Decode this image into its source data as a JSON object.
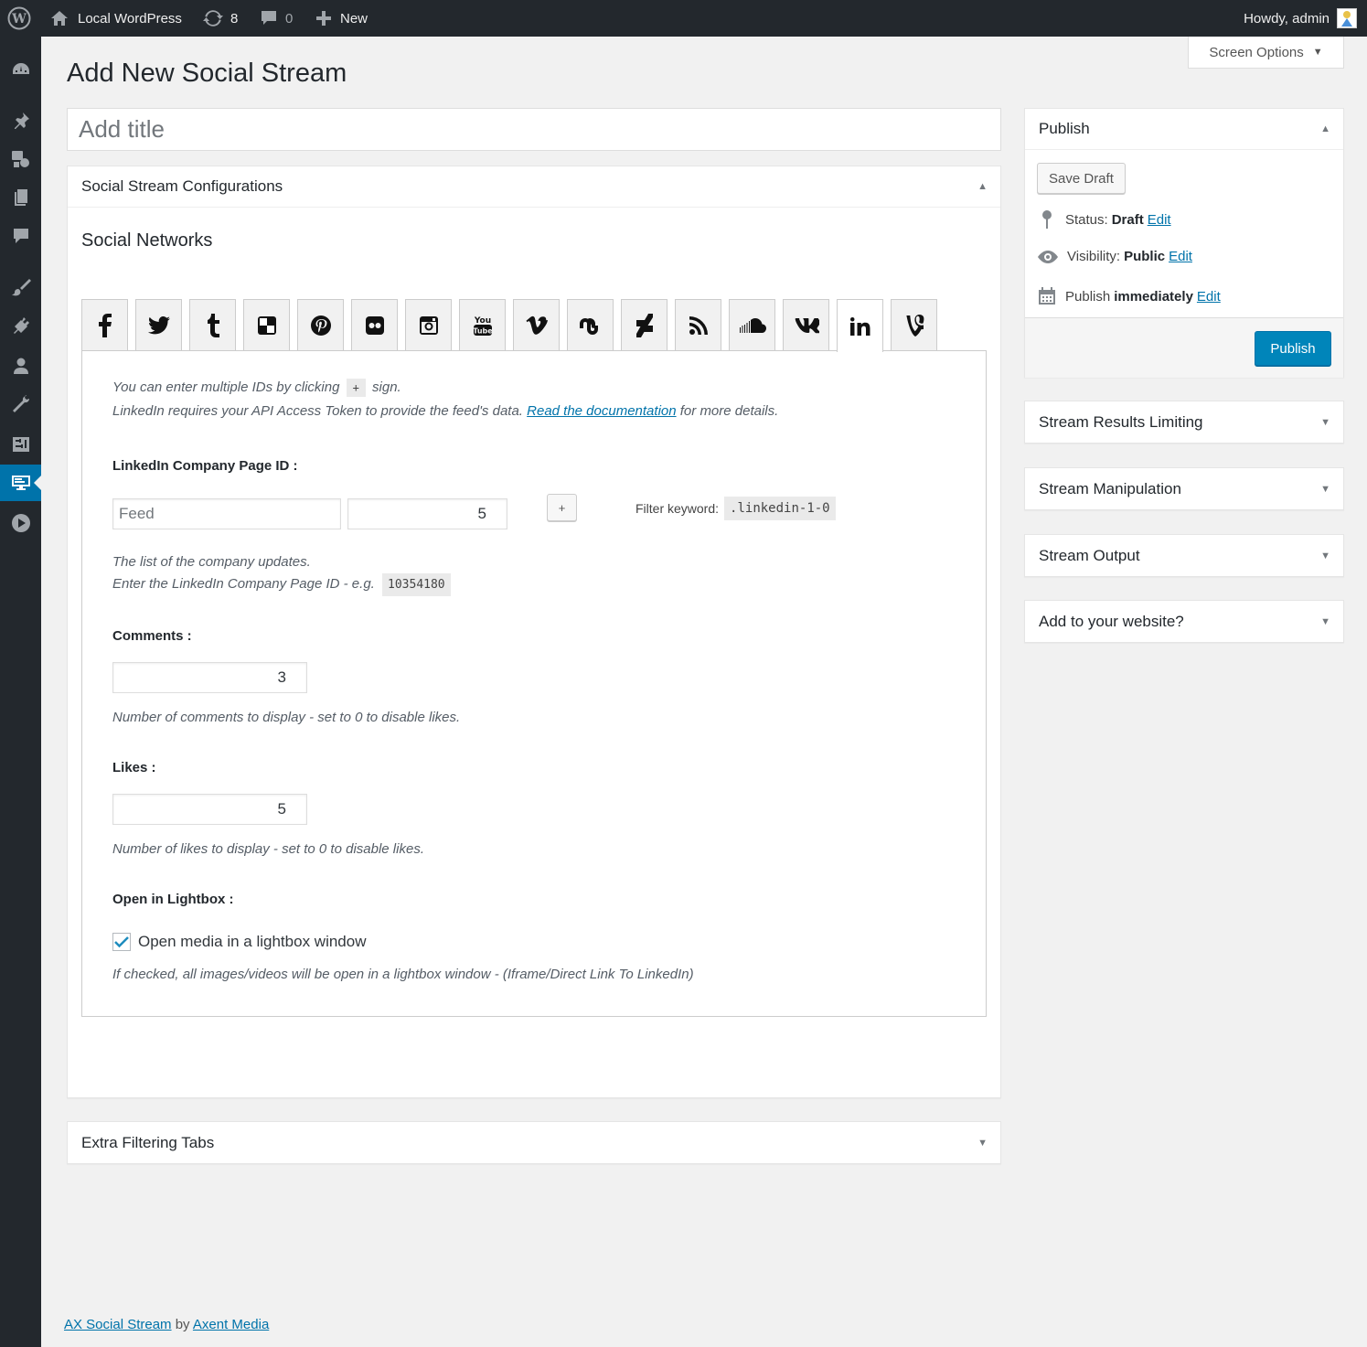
{
  "adminbar": {
    "site_name": "Local WordPress",
    "updates_count": "8",
    "comments_count": "0",
    "new_label": "New",
    "howdy": "Howdy, admin"
  },
  "screen_options": {
    "label": "Screen Options"
  },
  "page_title": "Add New Social Stream",
  "title_field": {
    "placeholder": "Add title",
    "value": ""
  },
  "config_box": {
    "title": "Social Stream Configurations",
    "section_title": "Social Networks",
    "networks": [
      {
        "name": "facebook",
        "glyph": "f"
      },
      {
        "name": "twitter",
        "glyph": "t"
      },
      {
        "name": "tumblr",
        "glyph": "t"
      },
      {
        "name": "delicious",
        "glyph": ""
      },
      {
        "name": "pinterest",
        "glyph": "p"
      },
      {
        "name": "flickr",
        "glyph": ""
      },
      {
        "name": "instagram",
        "glyph": ""
      },
      {
        "name": "youtube",
        "glyph": ""
      },
      {
        "name": "vimeo",
        "glyph": "v"
      },
      {
        "name": "stumbleupon",
        "glyph": ""
      },
      {
        "name": "deviantart",
        "glyph": ""
      },
      {
        "name": "rss",
        "glyph": ""
      },
      {
        "name": "soundcloud",
        "glyph": ""
      },
      {
        "name": "vk",
        "glyph": "vk"
      },
      {
        "name": "linkedin",
        "glyph": "in"
      },
      {
        "name": "vine",
        "glyph": "v"
      }
    ],
    "active_network": "linkedin",
    "panel": {
      "intro_line1_before": "You can enter multiple IDs by clicking",
      "intro_plus": "+",
      "intro_line1_after": "sign.",
      "intro_line2_before": "LinkedIn requires your API Access Token to provide the feed's data.",
      "intro_link": "Read the documentation",
      "intro_line2_after": "for more details.",
      "company_label": "LinkedIn Company Page ID :",
      "feed_placeholder": "Feed",
      "feed_count": "5",
      "add_label": "+",
      "filter_label": "Filter keyword:",
      "filter_value": ".linkedin-1-0",
      "company_desc1": "The list of the company updates.",
      "company_desc2": "Enter the LinkedIn Company Page ID - e.g.",
      "company_example": "10354180",
      "comments_label": "Comments :",
      "comments_value": "3",
      "comments_desc": "Number of comments to display - set to 0 to disable likes.",
      "likes_label": "Likes :",
      "likes_value": "5",
      "likes_desc": "Number of likes to display - set to 0 to disable likes.",
      "lightbox_label": "Open in Lightbox :",
      "lightbox_checkbox": "Open media in a lightbox window",
      "lightbox_checked": true,
      "lightbox_desc": "If checked, all images/videos will be open in a lightbox window - (Iframe/Direct Link To LinkedIn)"
    }
  },
  "extra_box": {
    "title": "Extra Filtering Tabs"
  },
  "publish_box": {
    "title": "Publish",
    "save_draft": "Save Draft",
    "status_label": "Status:",
    "status_value": "Draft",
    "visibility_label": "Visibility:",
    "visibility_value": "Public",
    "publish_label": "Publish",
    "publish_value": "immediately",
    "edit": "Edit",
    "publish_button": "Publish"
  },
  "side_boxes": [
    {
      "title": "Stream Results Limiting"
    },
    {
      "title": "Stream Manipulation"
    },
    {
      "title": "Stream Output"
    },
    {
      "title": "Add to your website?"
    }
  ],
  "footer": {
    "plugin_link": "AX Social Stream",
    "by": "by",
    "author_link": "Axent Media"
  },
  "colors": {
    "primary": "#0085ba",
    "menu_bg": "#23282d",
    "menu_current": "#0073aa",
    "link": "#0073aa"
  }
}
